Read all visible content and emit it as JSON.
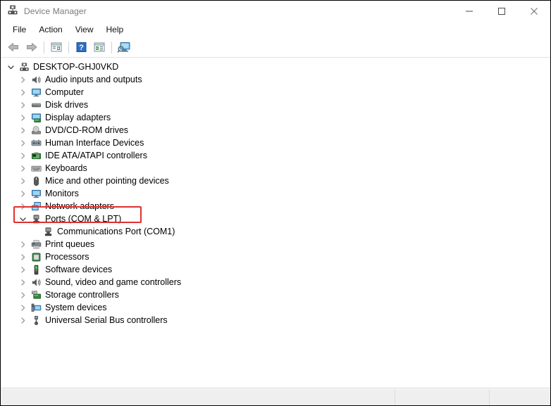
{
  "window": {
    "title": "Device Manager",
    "title_icon": "device-manager-icon"
  },
  "window_controls": {
    "minimize": "minimize-icon",
    "maximize": "maximize-icon",
    "close": "close-icon"
  },
  "menu": {
    "items": [
      {
        "label": "File"
      },
      {
        "label": "Action"
      },
      {
        "label": "View"
      },
      {
        "label": "Help"
      }
    ]
  },
  "toolbar": {
    "buttons": [
      {
        "name": "back-button",
        "icon": "back-arrow-icon"
      },
      {
        "name": "forward-button",
        "icon": "forward-arrow-icon"
      },
      {
        "name": "properties-button",
        "icon": "properties-icon"
      },
      {
        "name": "help-button",
        "icon": "help-icon"
      },
      {
        "name": "update-driver-button",
        "icon": "update-driver-icon"
      },
      {
        "name": "scan-hardware-changes-button",
        "icon": "scan-hardware-icon"
      }
    ]
  },
  "tree": {
    "root": {
      "label": "DESKTOP-GHJ0VKD",
      "icon": "computer-node-icon",
      "expanded": true
    },
    "items": [
      {
        "label": "Audio inputs and outputs",
        "icon": "speaker-icon",
        "expanded": false,
        "depth": 1
      },
      {
        "label": "Computer",
        "icon": "monitor-icon",
        "expanded": false,
        "depth": 1
      },
      {
        "label": "Disk drives",
        "icon": "disk-drive-icon",
        "expanded": false,
        "depth": 1
      },
      {
        "label": "Display adapters",
        "icon": "display-adapter-icon",
        "expanded": false,
        "depth": 1
      },
      {
        "label": "DVD/CD-ROM drives",
        "icon": "optical-drive-icon",
        "expanded": false,
        "depth": 1
      },
      {
        "label": "Human Interface Devices",
        "icon": "hid-icon",
        "expanded": false,
        "depth": 1
      },
      {
        "label": "IDE ATA/ATAPI controllers",
        "icon": "ide-controller-icon",
        "expanded": false,
        "depth": 1
      },
      {
        "label": "Keyboards",
        "icon": "keyboard-icon",
        "expanded": false,
        "depth": 1
      },
      {
        "label": "Mice and other pointing devices",
        "icon": "mouse-icon",
        "expanded": false,
        "depth": 1
      },
      {
        "label": "Monitors",
        "icon": "monitor-icon",
        "expanded": false,
        "depth": 1
      },
      {
        "label": "Network adapters",
        "icon": "network-adapter-icon",
        "expanded": false,
        "depth": 1
      },
      {
        "label": "Ports (COM & LPT)",
        "icon": "port-icon",
        "expanded": true,
        "depth": 1,
        "highlighted": true
      },
      {
        "label": "Communications Port (COM1)",
        "icon": "port-icon",
        "expanded": null,
        "depth": 2
      },
      {
        "label": "Print queues",
        "icon": "printer-icon",
        "expanded": false,
        "depth": 1
      },
      {
        "label": "Processors",
        "icon": "processor-icon",
        "expanded": false,
        "depth": 1
      },
      {
        "label": "Software devices",
        "icon": "software-device-icon",
        "expanded": false,
        "depth": 1
      },
      {
        "label": "Sound, video and game controllers",
        "icon": "speaker-icon",
        "expanded": false,
        "depth": 1
      },
      {
        "label": "Storage controllers",
        "icon": "storage-controller-icon",
        "expanded": false,
        "depth": 1
      },
      {
        "label": "System devices",
        "icon": "system-device-icon",
        "expanded": false,
        "depth": 1
      },
      {
        "label": "Universal Serial Bus controllers",
        "icon": "usb-controller-icon",
        "expanded": false,
        "depth": 1
      }
    ]
  },
  "annotation": {
    "target_label": "Ports (COM & LPT)",
    "color": "#e03030"
  },
  "statusbar": {
    "cells": [
      "",
      "",
      ""
    ]
  },
  "colors": {
    "accent_red": "#e03030",
    "titlebar_text": "#7a7a7a",
    "content_bg": "#ffffff",
    "statusbar_bg": "#efefef"
  }
}
